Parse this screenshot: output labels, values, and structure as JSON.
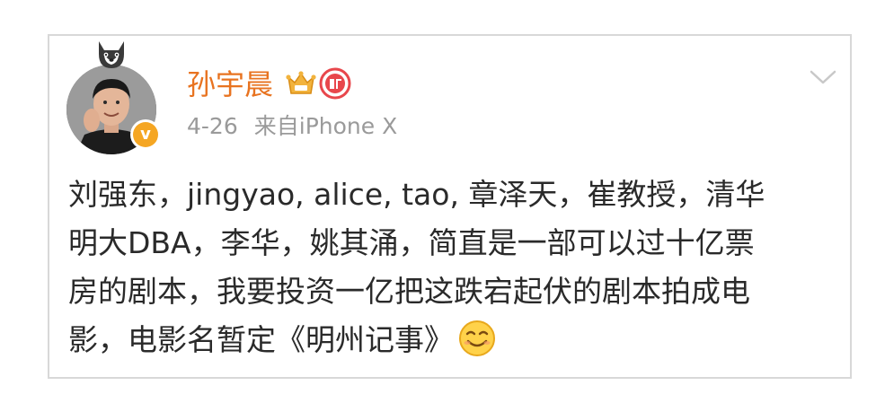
{
  "post": {
    "username": "孙宇晨",
    "time": "4-26",
    "source": "来自iPhone X",
    "text_lines": [
      "刘强东，jingyao, alice, tao, 章泽天，崔教授，清华",
      "明大DBA，李华，姚其涌，简直是一部可以过十亿票",
      "房的剧本，我要投资一亿把这跌宕起伏的剧本拍成电",
      "影，电影名暂定《明州记事》"
    ],
    "verified_badge_glyph": "v",
    "icons": {
      "avatar_decoration": "husky-icon",
      "membership": "vip-crown-icon",
      "level": "level-badge-icon",
      "menu": "chevron-down-icon",
      "emoji": "smile-icon",
      "verified": "verified-badge"
    },
    "colors": {
      "username": "#e87320",
      "meta": "#9a9a9a",
      "text": "#2a2a2a",
      "verified": "#f5a623",
      "border": "#d8d8d8"
    }
  }
}
